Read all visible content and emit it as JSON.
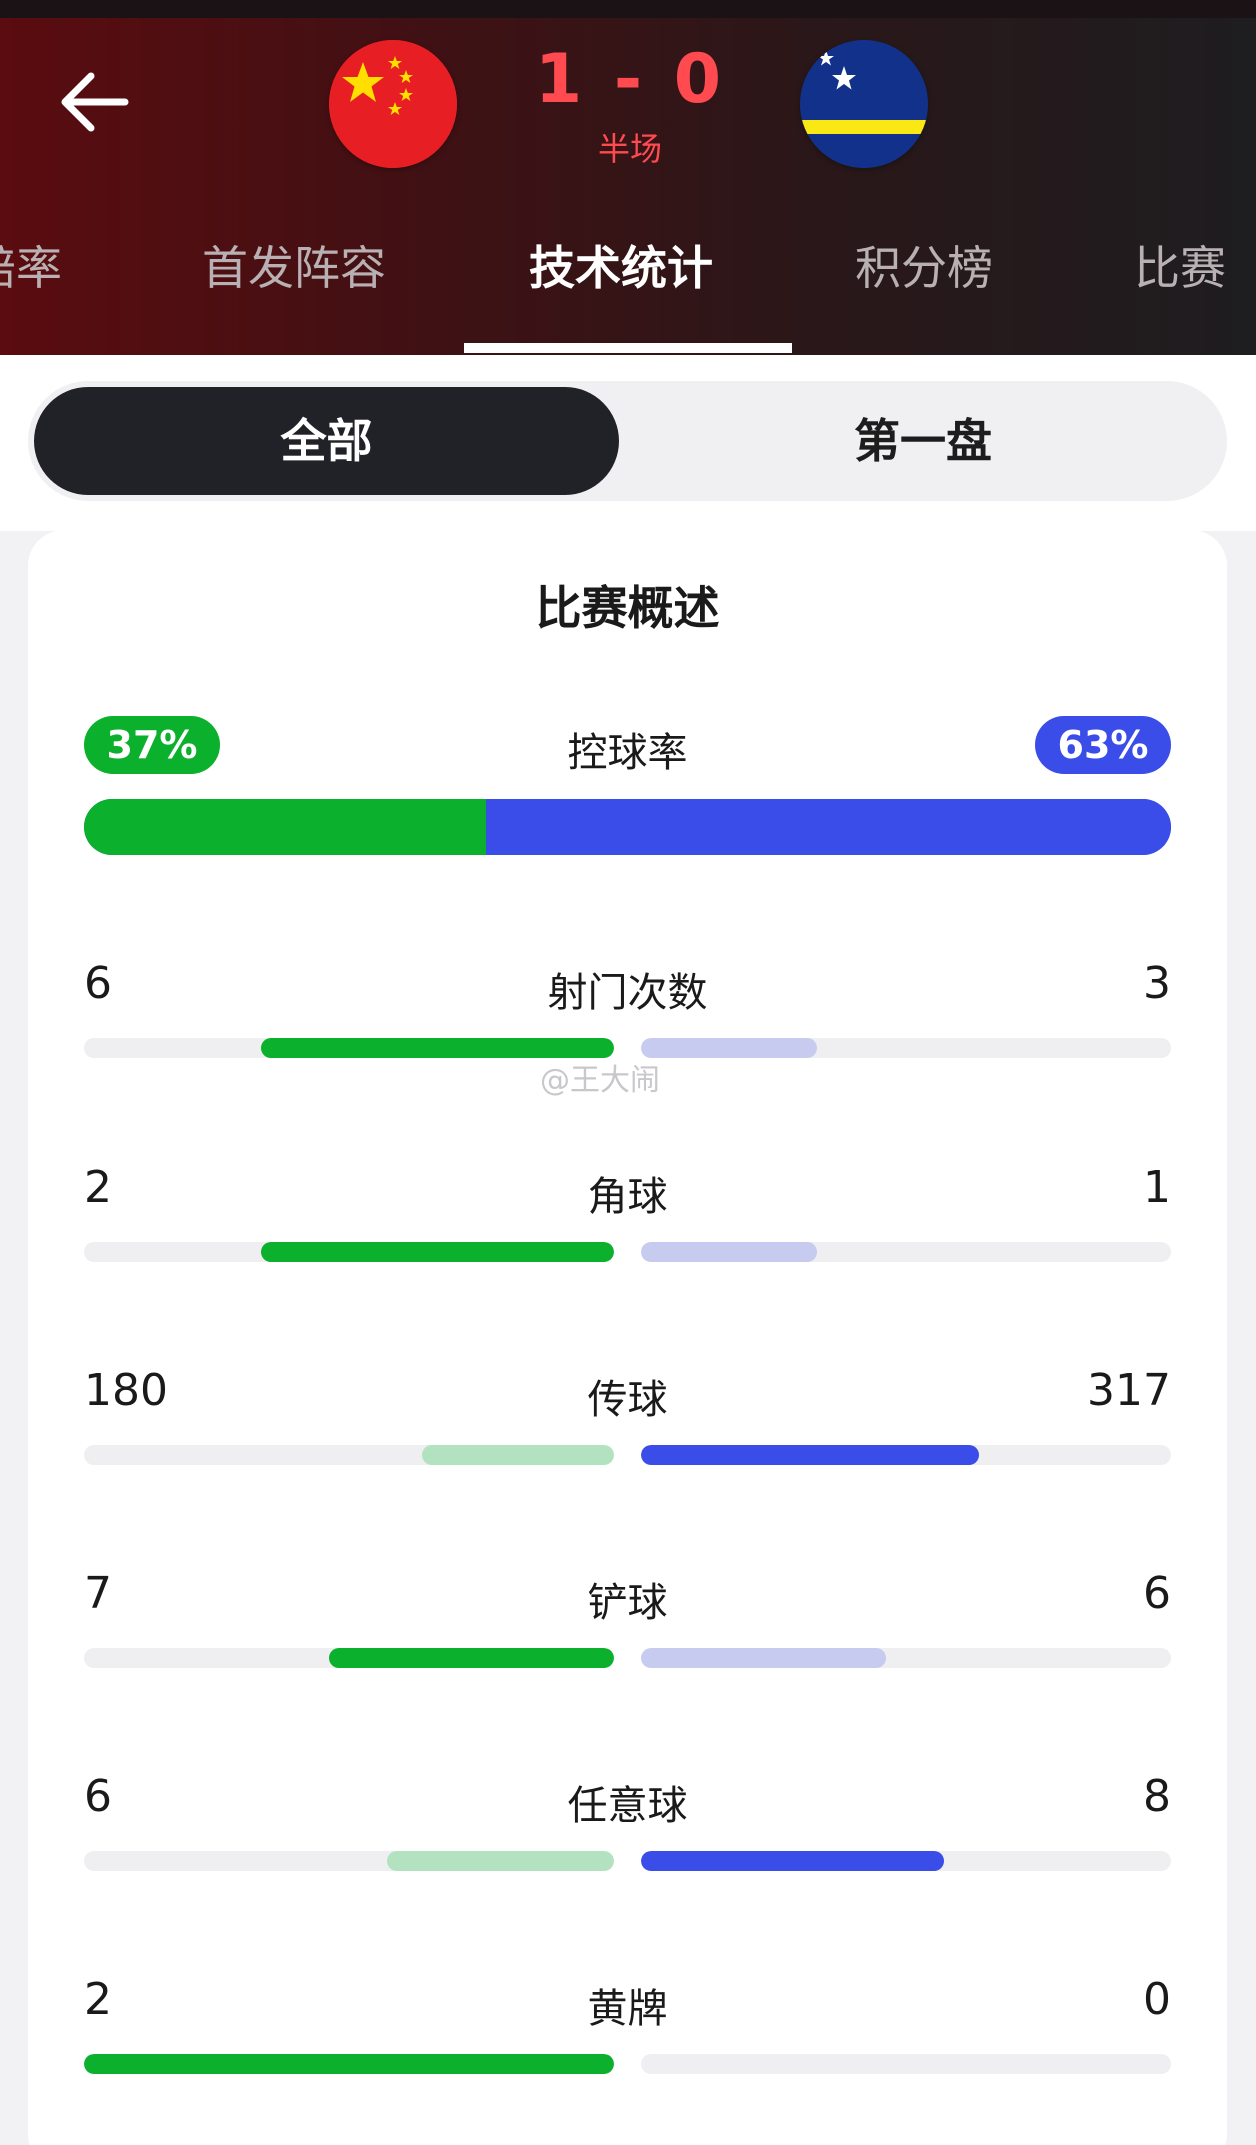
{
  "header": {
    "back_icon": "arrow-left-icon",
    "home_team": {
      "flag": "china-flag",
      "flag_color": "#e81e25"
    },
    "away_team": {
      "flag": "curacao-flag",
      "flag_color": "#12318a"
    },
    "score": "1 - 0",
    "status": "半场",
    "score_color": "#ff4a4f",
    "tabs": [
      {
        "label": "赔率",
        "active": false
      },
      {
        "label": "首发阵容",
        "active": false
      },
      {
        "label": "技术统计",
        "active": true
      },
      {
        "label": "积分榜",
        "active": false
      },
      {
        "label": "比赛",
        "active": false
      }
    ]
  },
  "segment": {
    "options": [
      {
        "label": "全部",
        "selected": true
      },
      {
        "label": "第一盘",
        "selected": false
      }
    ]
  },
  "card": {
    "title": "比赛概述",
    "possession": {
      "label": "控球率",
      "home": "37%",
      "away": "63%",
      "home_fraction": 0.37,
      "away_fraction": 0.63,
      "home_color": "#0bb02c",
      "away_color": "#3a4de8"
    },
    "stats": [
      {
        "label": "射门次数",
        "home": "6",
        "away": "3",
        "home_fraction": 0.667,
        "away_fraction": 0.333,
        "leader": "home"
      },
      {
        "label": "角球",
        "home": "2",
        "away": "1",
        "home_fraction": 0.667,
        "away_fraction": 0.333,
        "leader": "home"
      },
      {
        "label": "传球",
        "home": "180",
        "away": "317",
        "home_fraction": 0.362,
        "away_fraction": 0.638,
        "leader": "away"
      },
      {
        "label": "铲球",
        "home": "7",
        "away": "6",
        "home_fraction": 0.538,
        "away_fraction": 0.462,
        "leader": "home"
      },
      {
        "label": "任意球",
        "home": "6",
        "away": "8",
        "home_fraction": 0.429,
        "away_fraction": 0.571,
        "leader": "away"
      },
      {
        "label": "黄牌",
        "home": "2",
        "away": "0",
        "home_fraction": 1.0,
        "away_fraction": 0.0,
        "leader": "home"
      }
    ],
    "colors": {
      "home_strong": "#0bb02c",
      "home_light": "#b3e2c0",
      "away_strong": "#3a4de8",
      "away_light": "#c6cbef"
    }
  },
  "watermark": "@王大闹"
}
